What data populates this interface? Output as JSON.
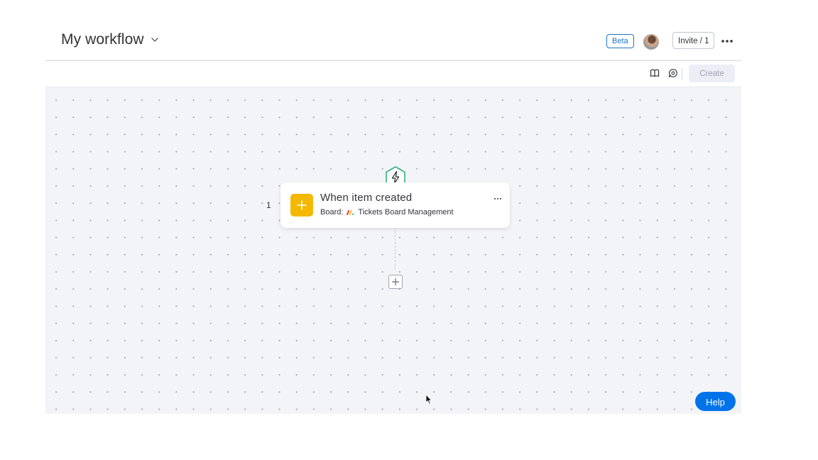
{
  "header": {
    "title": "My workflow",
    "beta_label": "Beta",
    "invite_label": "Invite / 1"
  },
  "toolbar": {
    "create_label": "Create",
    "icons": [
      "book-icon",
      "chat-icon"
    ]
  },
  "workflow": {
    "step_number": "1",
    "trigger": {
      "title": "When item created",
      "board_label": "Board:",
      "board_name": "Tickets Board Management"
    }
  },
  "help_label": "Help",
  "colors": {
    "accent": "#0073ea",
    "trigger_icon_bg": "#f5b800",
    "hex_green": "#33b37d",
    "canvas_bg": "#f3f4f8"
  }
}
